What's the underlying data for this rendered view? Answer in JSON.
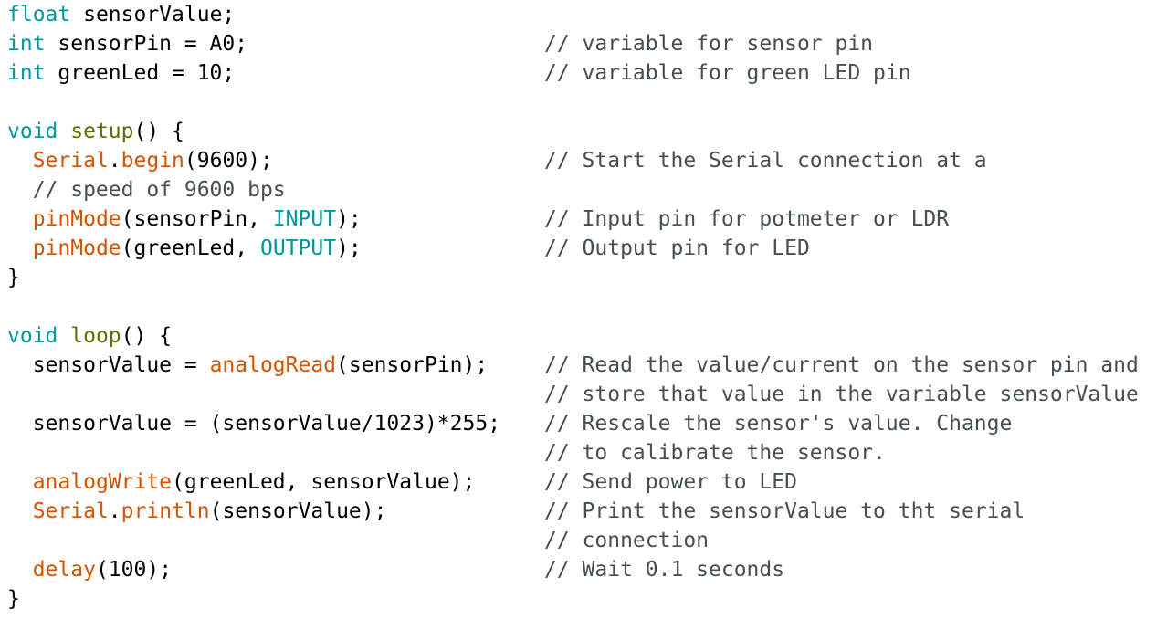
{
  "colors": {
    "background": "#ffffff",
    "type_keyword": "#00979c",
    "function": "#d35400",
    "structure_function": "#5e6d03",
    "comment": "#434f54",
    "plain": "#000000"
  },
  "lines": [
    {
      "tokens": [
        {
          "t": "float",
          "c": "kw"
        },
        {
          "t": " sensorValue;",
          "c": "plain"
        }
      ],
      "comment": ""
    },
    {
      "tokens": [
        {
          "t": "int",
          "c": "kw"
        },
        {
          "t": " sensorPin = A0;",
          "c": "plain"
        }
      ],
      "comment": "// variable for sensor pin"
    },
    {
      "tokens": [
        {
          "t": "int",
          "c": "kw"
        },
        {
          "t": " greenLed = 10;",
          "c": "plain"
        }
      ],
      "comment": "// variable for green LED pin"
    },
    {
      "tokens": [],
      "comment": ""
    },
    {
      "tokens": [
        {
          "t": "void",
          "c": "kw"
        },
        {
          "t": " ",
          "c": "plain"
        },
        {
          "t": "setup",
          "c": "sfn"
        },
        {
          "t": "() {",
          "c": "plain"
        }
      ],
      "comment": ""
    },
    {
      "tokens": [
        {
          "t": "  ",
          "c": "plain"
        },
        {
          "t": "Serial",
          "c": "fn"
        },
        {
          "t": ".",
          "c": "plain"
        },
        {
          "t": "begin",
          "c": "fn"
        },
        {
          "t": "(9600);",
          "c": "plain"
        }
      ],
      "comment": "// Start the Serial connection at a"
    },
    {
      "tokens": [
        {
          "t": "  // speed of 9600 bps",
          "c": "cmt"
        }
      ],
      "comment": ""
    },
    {
      "tokens": [
        {
          "t": "  ",
          "c": "plain"
        },
        {
          "t": "pinMode",
          "c": "fn"
        },
        {
          "t": "(sensorPin, ",
          "c": "plain"
        },
        {
          "t": "INPUT",
          "c": "kw"
        },
        {
          "t": ");",
          "c": "plain"
        }
      ],
      "comment": "// Input pin for potmeter or LDR"
    },
    {
      "tokens": [
        {
          "t": "  ",
          "c": "plain"
        },
        {
          "t": "pinMode",
          "c": "fn"
        },
        {
          "t": "(greenLed, ",
          "c": "plain"
        },
        {
          "t": "OUTPUT",
          "c": "kw"
        },
        {
          "t": ");",
          "c": "plain"
        }
      ],
      "comment": "// Output pin for LED"
    },
    {
      "tokens": [
        {
          "t": "}",
          "c": "plain"
        }
      ],
      "comment": ""
    },
    {
      "tokens": [],
      "comment": ""
    },
    {
      "tokens": [
        {
          "t": "void",
          "c": "kw"
        },
        {
          "t": " ",
          "c": "plain"
        },
        {
          "t": "loop",
          "c": "sfn"
        },
        {
          "t": "() {",
          "c": "plain"
        }
      ],
      "comment": ""
    },
    {
      "tokens": [
        {
          "t": "  sensorValue = ",
          "c": "plain"
        },
        {
          "t": "analogRead",
          "c": "fn"
        },
        {
          "t": "(sensorPin);",
          "c": "plain"
        }
      ],
      "comment": "// Read the value/current on the sensor pin and"
    },
    {
      "tokens": [],
      "comment": "// store that value in the variable sensorValue"
    },
    {
      "tokens": [
        {
          "t": "  sensorValue = (sensorValue/1023)*255;",
          "c": "plain"
        }
      ],
      "comment": "// Rescale the sensor's value. Change"
    },
    {
      "tokens": [],
      "comment": "// to calibrate the sensor."
    },
    {
      "tokens": [
        {
          "t": "  ",
          "c": "plain"
        },
        {
          "t": "analogWrite",
          "c": "fn"
        },
        {
          "t": "(greenLed, sensorValue);",
          "c": "plain"
        }
      ],
      "comment": "// Send power to LED"
    },
    {
      "tokens": [
        {
          "t": "  ",
          "c": "plain"
        },
        {
          "t": "Serial",
          "c": "fn"
        },
        {
          "t": ".",
          "c": "plain"
        },
        {
          "t": "println",
          "c": "fn"
        },
        {
          "t": "(sensorValue);",
          "c": "plain"
        }
      ],
      "comment": "// Print the sensorValue to tht serial"
    },
    {
      "tokens": [],
      "comment": "// connection"
    },
    {
      "tokens": [
        {
          "t": "  ",
          "c": "plain"
        },
        {
          "t": "delay",
          "c": "fn"
        },
        {
          "t": "(100);",
          "c": "plain"
        }
      ],
      "comment": "// Wait 0.1 seconds"
    },
    {
      "tokens": [
        {
          "t": "}",
          "c": "plain"
        }
      ],
      "comment": ""
    }
  ]
}
